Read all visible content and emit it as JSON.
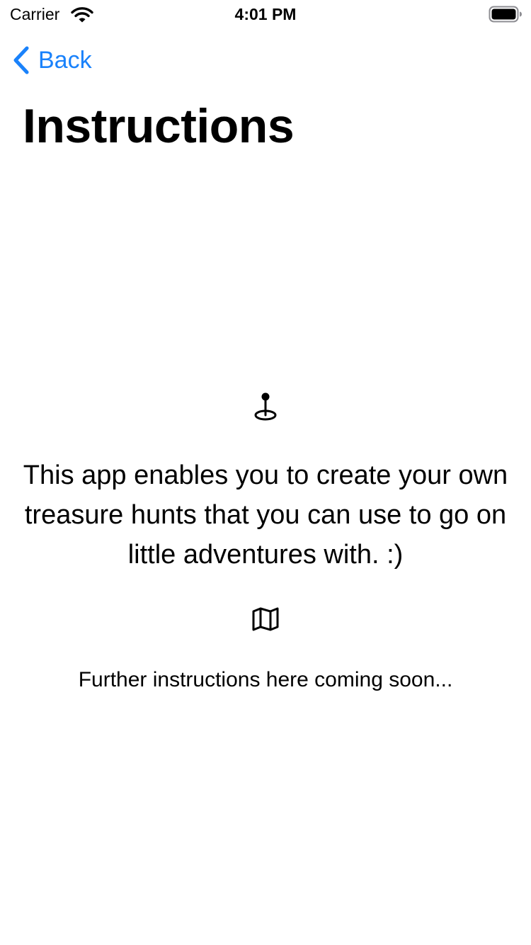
{
  "status_bar": {
    "carrier": "Carrier",
    "time": "4:01 PM",
    "icons": [
      "wifi-icon",
      "battery-icon"
    ]
  },
  "nav": {
    "back_label": "Back",
    "back_icon": "chevron-left-icon",
    "accent_color": "#1a82fb"
  },
  "page": {
    "title": "Instructions",
    "intro_icon": "map-pin-icon",
    "intro_text": "This app enables you to create your own treasure hunts that you can use to go on little adventures with. :)",
    "secondary_icon": "map-icon",
    "further_text": "Further instructions here coming soon..."
  }
}
